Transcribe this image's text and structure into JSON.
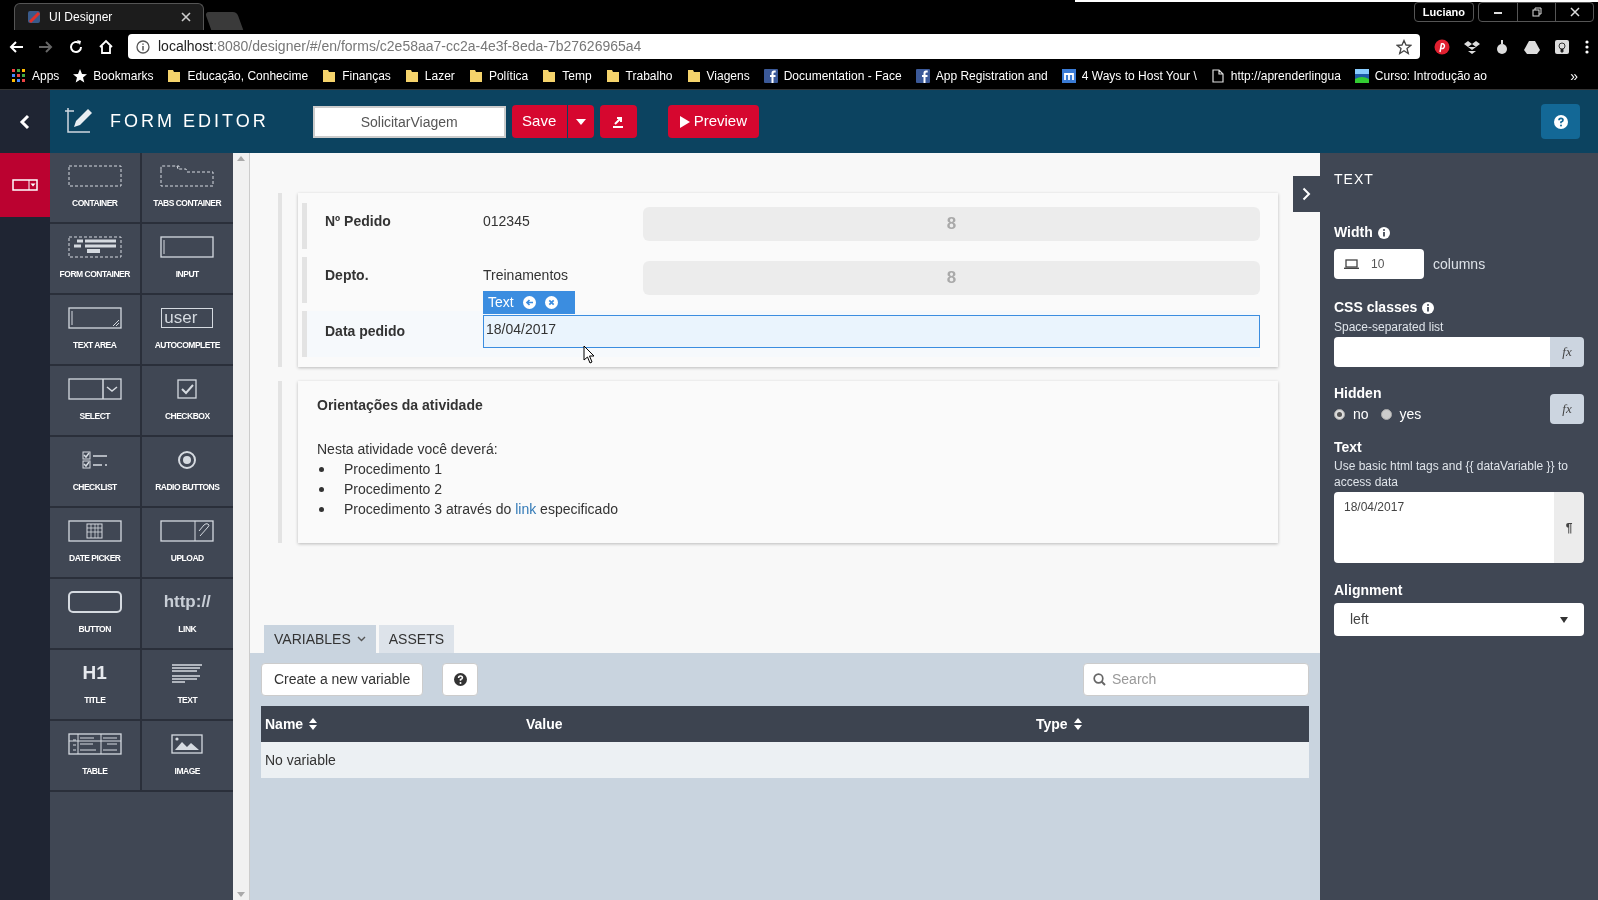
{
  "browser": {
    "tab_title": "UI Designer",
    "url_host": "localhost",
    "url_rest": ":8080/designer/#/en/forms/c2e58aa7-cc2a-4e3f-8eda-7b27626965a4",
    "profile": "Luciano",
    "bookmarks": [
      {
        "label": "Apps",
        "kind": "apps"
      },
      {
        "label": "Bookmarks",
        "kind": "star"
      },
      {
        "label": "Educação, Conhecime",
        "kind": "folder"
      },
      {
        "label": "Finanças",
        "kind": "folder"
      },
      {
        "label": "Lazer",
        "kind": "folder"
      },
      {
        "label": "Política",
        "kind": "folder"
      },
      {
        "label": "Temp",
        "kind": "folder"
      },
      {
        "label": "Trabalho",
        "kind": "folder"
      },
      {
        "label": "Viagens",
        "kind": "folder"
      },
      {
        "label": "Documentation - Face",
        "kind": "facebook"
      },
      {
        "label": "App Registration and",
        "kind": "facebook"
      },
      {
        "label": "4 Ways to Host Your \\",
        "kind": "m"
      },
      {
        "label": "http://aprenderlingua",
        "kind": "page"
      },
      {
        "label": "Curso: Introdução ao",
        "kind": "course"
      }
    ],
    "more": "»"
  },
  "header": {
    "title": "FORM EDITOR",
    "form_name": "SolicitarViagem",
    "save": "Save",
    "preview": "Preview"
  },
  "palette_rows": [
    {
      "items": [
        {
          "label": "CONTAINER",
          "kind": "container"
        },
        {
          "label": "TABS CONTAINER",
          "kind": "tabs"
        }
      ]
    },
    {
      "items": [
        {
          "label": "FORM CONTAINER",
          "kind": "form"
        },
        {
          "label": "INPUT",
          "kind": "input"
        }
      ]
    },
    {
      "items": [
        {
          "label": "TEXT AREA",
          "kind": "textarea"
        },
        {
          "label": "AUTOCOMPLETE",
          "kind": "autocomplete",
          "sample": "user"
        }
      ]
    },
    {
      "items": [
        {
          "label": "SELECT",
          "kind": "select"
        },
        {
          "label": "CHECKBOX",
          "kind": "checkbox"
        }
      ]
    },
    {
      "items": [
        {
          "label": "CHECKLIST",
          "kind": "checklist"
        },
        {
          "label": "RADIO BUTTONS",
          "kind": "radio"
        }
      ]
    },
    {
      "items": [
        {
          "label": "DATE PICKER",
          "kind": "date"
        },
        {
          "label": "UPLOAD",
          "kind": "upload"
        }
      ]
    },
    {
      "items": [
        {
          "label": "BUTTON",
          "kind": "button"
        },
        {
          "label": "LINK",
          "kind": "link",
          "sample": "http://"
        }
      ]
    },
    {
      "items": [
        {
          "label": "TITLE",
          "kind": "title",
          "sample": "H1"
        },
        {
          "label": "TEXT",
          "kind": "text"
        }
      ]
    },
    {
      "items": [
        {
          "label": "TABLE",
          "kind": "table"
        },
        {
          "label": "IMAGE",
          "kind": "image"
        }
      ]
    }
  ],
  "form_rows": [
    {
      "label": "Nº Pedido",
      "value": "012345",
      "width_badge": "8",
      "selected": false
    },
    {
      "label": "Depto.",
      "value": "Treinamentos",
      "width_badge": "8",
      "selected": false
    },
    {
      "label": "Data pedido",
      "value": "18/04/2017",
      "selected": true,
      "toolbar_label": "Text"
    }
  ],
  "instructions": {
    "title": "Orientações da atividade",
    "intro": "Nesta atividade você deverá:",
    "items": [
      {
        "text": "Procedimento 1"
      },
      {
        "text": "Procedimento 2"
      },
      {
        "text": "Procedimento 3 através do",
        "link": "link",
        "after": "especificado"
      }
    ]
  },
  "bottom": {
    "tabs": [
      {
        "label": "VARIABLES",
        "selected": true
      },
      {
        "label": "ASSETS",
        "selected": false
      }
    ],
    "create_button": "Create a new variable",
    "search_placeholder": "Search",
    "columns": [
      {
        "label": "Name",
        "sortable": true
      },
      {
        "label": "Value",
        "sortable": false
      },
      {
        "label": "Type",
        "sortable": true
      }
    ],
    "empty": "No variable"
  },
  "properties": {
    "title": "TEXT",
    "width_label": "Width",
    "width_value": "10",
    "width_unit": "columns",
    "css_label": "CSS classes",
    "css_hint": "Space-separated list",
    "hidden_label": "Hidden",
    "hidden_options": [
      {
        "label": "no",
        "selected": true
      },
      {
        "label": "yes",
        "selected": false
      }
    ],
    "text_label": "Text",
    "text_hint": "Use basic html tags and {{ dataVariable }} to access data",
    "text_value": "18/04/2017",
    "css_fx": "fx",
    "hidden_fx": "fx",
    "pilcrow": "¶",
    "alignment_label": "Alignment",
    "alignment_value": "left"
  }
}
